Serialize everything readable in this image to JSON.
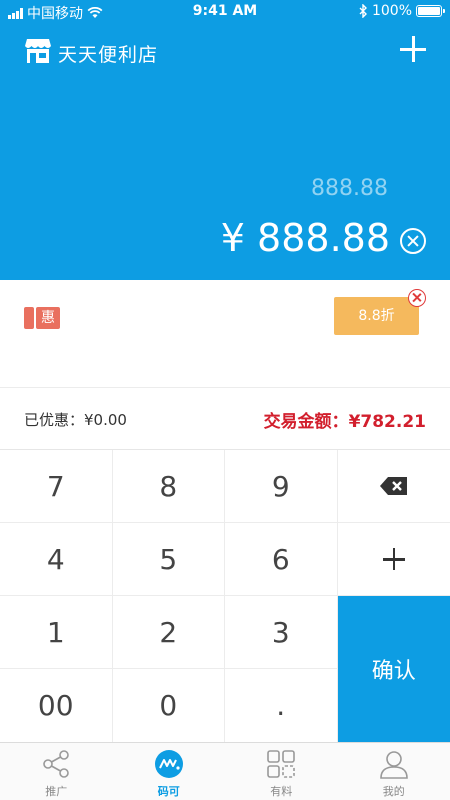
{
  "status_bar": {
    "carrier": "中国移动",
    "time": "9:41 AM",
    "battery": "100%"
  },
  "header": {
    "store_name": "天天便利店",
    "add_icon": "plus-icon"
  },
  "amount": {
    "input_value": "888.88",
    "display_value": "¥ 888.88"
  },
  "discount": {
    "tag_label": "惠",
    "chip_label": "8.8折"
  },
  "summary": {
    "saved_label": "已优惠：",
    "saved_value": "¥0.00",
    "total_label": "交易金额：",
    "total_value": "¥782.21"
  },
  "keypad": {
    "keys": [
      "7",
      "8",
      "9",
      "4",
      "5",
      "6",
      "1",
      "2",
      "3",
      "00",
      "0",
      "."
    ],
    "confirm_label": "确认"
  },
  "tabs": [
    {
      "label": "推广",
      "icon": "share-icon"
    },
    {
      "label": "码可",
      "icon": "brand-logo-icon"
    },
    {
      "label": "有料",
      "icon": "grid-icon"
    },
    {
      "label": "我的",
      "icon": "user-icon"
    }
  ],
  "colors": {
    "primary": "#0d9de3",
    "discount_chip": "#f5b95d",
    "coupon_tag": "#e9705f",
    "total_red": "#d21f2d"
  }
}
